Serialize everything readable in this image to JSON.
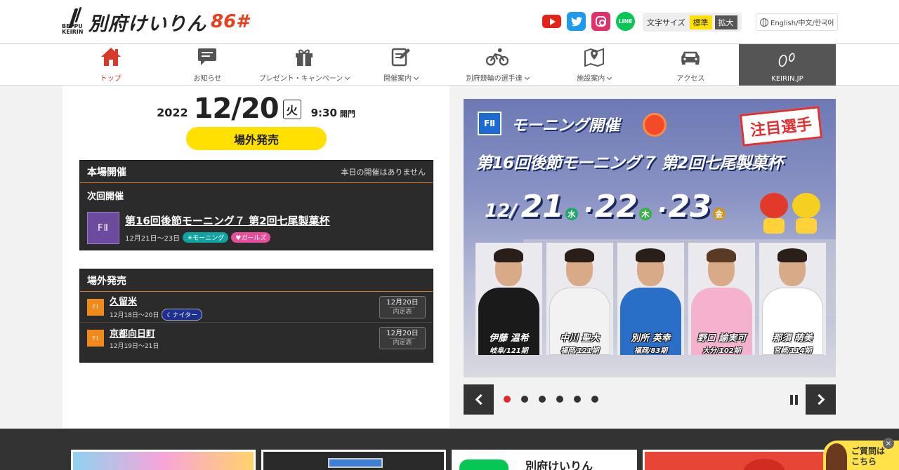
{
  "header": {
    "logo_mark": "BEPPU KEIRIN",
    "logo_name": "別府けいりん",
    "logo_suffix": "86#",
    "font_size": {
      "label": "文字サイズ",
      "options": [
        "標準",
        "拡大"
      ],
      "selected": "標準"
    },
    "language_label": "English/中文/한국어"
  },
  "nav": {
    "items": [
      {
        "label": "トップ",
        "icon": "home-icon",
        "active": true
      },
      {
        "label": "お知らせ",
        "icon": "speech-bubble-icon"
      },
      {
        "label": "プレゼント・キャンペーン",
        "icon": "gift-icon",
        "dropdown": true
      },
      {
        "label": "開催案内",
        "icon": "edit-document-icon",
        "dropdown": true
      },
      {
        "label": "別府競輪の選手達",
        "icon": "cyclist-icon",
        "dropdown": true
      },
      {
        "label": "施設案内",
        "icon": "map-pin-icon",
        "dropdown": true
      },
      {
        "label": "アクセス",
        "icon": "car-icon"
      },
      {
        "label": "KEIRIN.JP",
        "icon": "keirin-jp-logo-icon"
      }
    ]
  },
  "today": {
    "year": "2022",
    "month_day": "12/20",
    "weekday": "火",
    "time": "9:30",
    "open_label": "開門",
    "offsite_label": "場外発売"
  },
  "main_venue": {
    "title": "本場開催",
    "note": "本日の開催はありません",
    "next_label": "次回開催",
    "next_race": {
      "grade": "FⅡ",
      "title": "第16回後節モーニング７ 第2回七尾製菓杯",
      "dates": "12月21日〜23日",
      "tags": [
        "モーニング",
        "ガールズ"
      ]
    }
  },
  "offsite": {
    "title": "場外発売",
    "rows": [
      {
        "grade": "FⅠ",
        "name": "久留米",
        "dates": "12月18日〜20日",
        "tag": "ナイター",
        "btn_date": "12月20日",
        "btn_label": "内定表"
      },
      {
        "grade": "FⅠ",
        "name": "京都向日町",
        "dates": "12月19日〜21日",
        "btn_date": "12月20日",
        "btn_label": "内定表"
      }
    ]
  },
  "slider": {
    "badge": "FⅡ",
    "morning_label": "モーニング開催",
    "attention_label": "注目選手",
    "headline": "第16回後節モーニング７ 第2回七尾製菓杯",
    "month": "12/",
    "days": [
      {
        "day": "21",
        "weekday": "水"
      },
      {
        "day": "22",
        "weekday": "木"
      },
      {
        "day": "23",
        "weekday": "金"
      }
    ],
    "riders": [
      {
        "name": "伊藤 温希",
        "profile": "岐阜/121期",
        "jersey": "#1a1a1a"
      },
      {
        "name": "中川 聖大",
        "profile": "福岡/121期",
        "jersey": "#f2f2f2"
      },
      {
        "name": "別所 英幸",
        "profile": "福岡/83期",
        "jersey": "#2a6fc7"
      },
      {
        "name": "野口 諭実可",
        "profile": "大分/102期",
        "jersey": "#f5b2cf"
      },
      {
        "name": "那須 萌美",
        "profile": "宮崎/114期",
        "jersey": "#ffffff"
      }
    ],
    "slide_count": 6,
    "current_slide": 1
  },
  "banners": {
    "line_label": "別府けいりん"
  },
  "help": {
    "label": "ご質問は こちら",
    "close": "×"
  }
}
